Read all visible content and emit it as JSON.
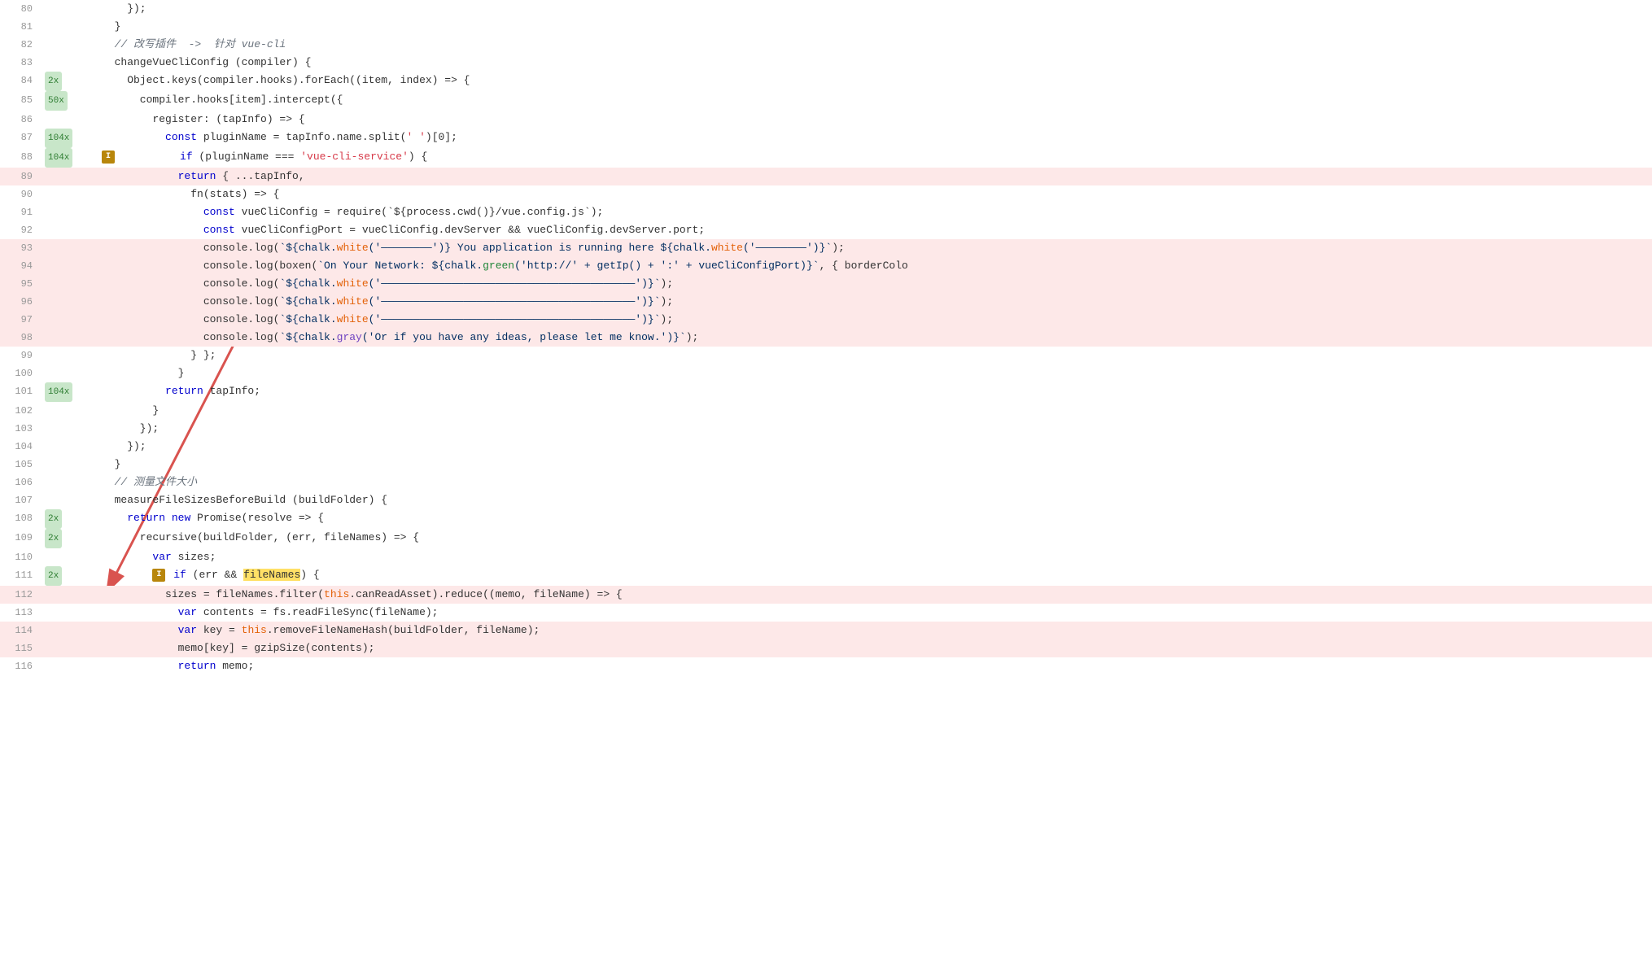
{
  "lines": [
    {
      "num": 80,
      "badge": "",
      "content": "    });",
      "highlighted": false
    },
    {
      "num": 81,
      "badge": "",
      "content": "  }",
      "highlighted": false
    },
    {
      "num": 82,
      "badge": "",
      "content": "  // 改写插件  ->  针对 vue-cli",
      "highlighted": false,
      "isComment": true
    },
    {
      "num": 83,
      "badge": "",
      "content": "  changeVueCliConfig (compiler) {",
      "highlighted": false
    },
    {
      "num": 84,
      "badge": "2x",
      "content": "    Object.keys(compiler.hooks).forEach((item, index) => {",
      "highlighted": false
    },
    {
      "num": 85,
      "badge": "50x",
      "content": "      compiler.hooks[item].intercept({",
      "highlighted": false
    },
    {
      "num": 86,
      "badge": "",
      "content": "        register: (tapInfo) => {",
      "highlighted": false
    },
    {
      "num": 87,
      "badge": "104x",
      "content": "          const pluginName = tapInfo.name.split(' ')[0];",
      "highlighted": false
    },
    {
      "num": 88,
      "badge": "104x",
      "content": "          if (pluginName === 'vue-cli-service') {",
      "highlighted": false,
      "hasWarn": true
    },
    {
      "num": 89,
      "badge": "",
      "content": "            return { ...tapInfo,",
      "highlighted": true
    },
    {
      "num": 90,
      "badge": "",
      "content": "              fn(stats) => {",
      "highlighted": false
    },
    {
      "num": 91,
      "badge": "",
      "content": "                const vueCliConfig = require(`${process.cwd()}/vue.config.js`);",
      "highlighted": false
    },
    {
      "num": 92,
      "badge": "",
      "content": "                const vueCliConfigPort = vueCliConfig.devServer && vueCliConfig.devServer.port;",
      "highlighted": false
    },
    {
      "num": 93,
      "badge": "",
      "content": "                console.log(`${chalk.white('————————')} You application is running here ${chalk.white('————————')}`);",
      "highlighted": true
    },
    {
      "num": 94,
      "badge": "",
      "content": "                console.log(boxen(`On Your Network: ${chalk.green('http://' + getIp() + ':' + vueCliConfigPort)}`, { borderColo",
      "highlighted": true
    },
    {
      "num": 95,
      "badge": "",
      "content": "                console.log(`${chalk.white('————————————————————————————————————————')}`);",
      "highlighted": true
    },
    {
      "num": 96,
      "badge": "",
      "content": "                console.log(`${chalk.white('————————————————————————————————————————')}`);",
      "highlighted": true
    },
    {
      "num": 97,
      "badge": "",
      "content": "                console.log(`${chalk.white('————————————————————————————————————————')}`);",
      "highlighted": true
    },
    {
      "num": 98,
      "badge": "",
      "content": "                console.log(`${chalk.gray('Or if you have any ideas, please let me know.')}`);",
      "highlighted": true
    },
    {
      "num": 99,
      "badge": "",
      "content": "              } };",
      "highlighted": false
    },
    {
      "num": 100,
      "badge": "",
      "content": "            }",
      "highlighted": false
    },
    {
      "num": 101,
      "badge": "104x",
      "content": "          return tapInfo;",
      "highlighted": false
    },
    {
      "num": 102,
      "badge": "",
      "content": "        }",
      "highlighted": false
    },
    {
      "num": 103,
      "badge": "",
      "content": "      });",
      "highlighted": false
    },
    {
      "num": 104,
      "badge": "",
      "content": "    });",
      "highlighted": false
    },
    {
      "num": 105,
      "badge": "",
      "content": "  }",
      "highlighted": false
    },
    {
      "num": 106,
      "badge": "",
      "content": "  // 测量文件大小",
      "highlighted": false,
      "isComment": true
    },
    {
      "num": 107,
      "badge": "",
      "content": "  measureFileSizesBeforeBuild (buildFolder) {",
      "highlighted": false
    },
    {
      "num": 108,
      "badge": "2x",
      "content": "    return new Promise(resolve => {",
      "highlighted": false
    },
    {
      "num": 109,
      "badge": "2x",
      "content": "      recursive(buildFolder, (err, fileNames) => {",
      "highlighted": false
    },
    {
      "num": 110,
      "badge": "",
      "content": "        var sizes;",
      "highlighted": false
    },
    {
      "num": 111,
      "badge": "2x",
      "content": "        if (err && fileNames) {",
      "highlighted": false,
      "hasWarn": true,
      "hlWords": [
        "fileNames"
      ]
    },
    {
      "num": 112,
      "badge": "",
      "content": "          sizes = fileNames.filter(this.canReadAsset).reduce((memo, fileName) => {",
      "highlighted": true
    },
    {
      "num": 113,
      "badge": "",
      "content": "            var contents = fs.readFileSync(fileName);",
      "highlighted": false
    },
    {
      "num": 114,
      "badge": "",
      "content": "            var key = this.removeFileNameHash(buildFolder, fileName);",
      "highlighted": true
    },
    {
      "num": 115,
      "badge": "",
      "content": "            memo[key] = gzipSize(contents);",
      "highlighted": true
    },
    {
      "num": 116,
      "badge": "",
      "content": "            return memo;",
      "highlighted": false
    }
  ]
}
